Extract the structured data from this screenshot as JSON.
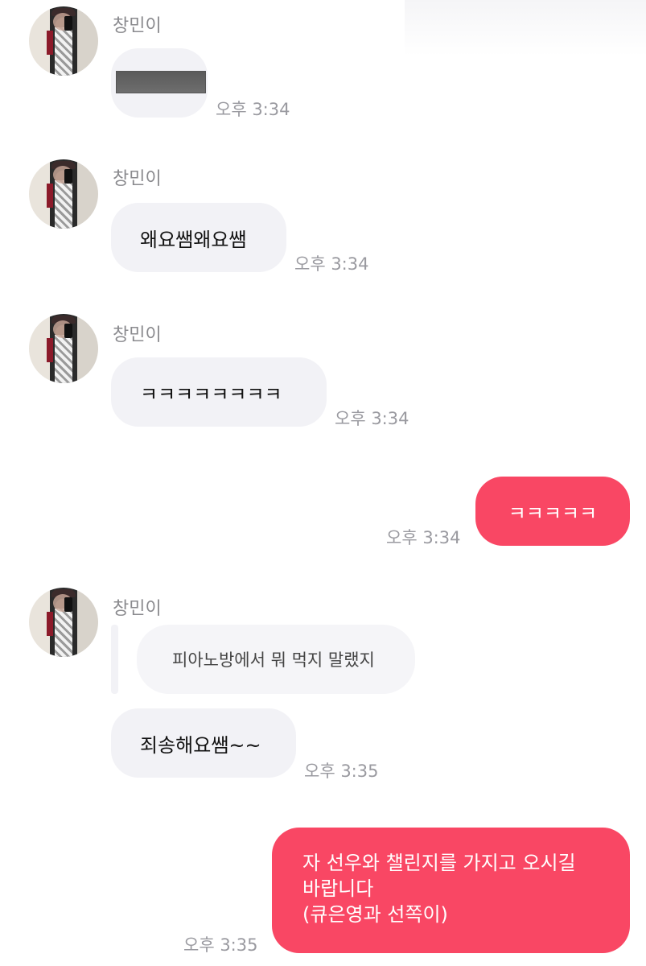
{
  "sender_name": "창민이",
  "messages": [
    {
      "type": "in",
      "text": "",
      "redacted": true,
      "time": "오후 3:34"
    },
    {
      "type": "in",
      "text": "왜요쌤왜요쌤",
      "time": "오후 3:34"
    },
    {
      "type": "in",
      "text": "ㅋㅋㅋㅋㅋㅋㅋㅋ",
      "time": "오후 3:34"
    },
    {
      "type": "out",
      "text": "ㅋㅋㅋㅋㅋ",
      "time": "오후 3:34"
    },
    {
      "type": "in",
      "quote": "피아노방에서 뭐 먹지 말랬지",
      "text": "죄송해요쌤~~",
      "time": "오후 3:35"
    },
    {
      "type": "out",
      "lines": [
        "자 선우와 챌린지를 가지고 오시길",
        "바랍니다",
        "(큐은영과 선쪽이)"
      ],
      "time": "오후 3:35"
    }
  ],
  "colors": {
    "outgoing": "#f94764",
    "incoming": "#f2f2f6",
    "timestamp": "#9a9aa0"
  }
}
